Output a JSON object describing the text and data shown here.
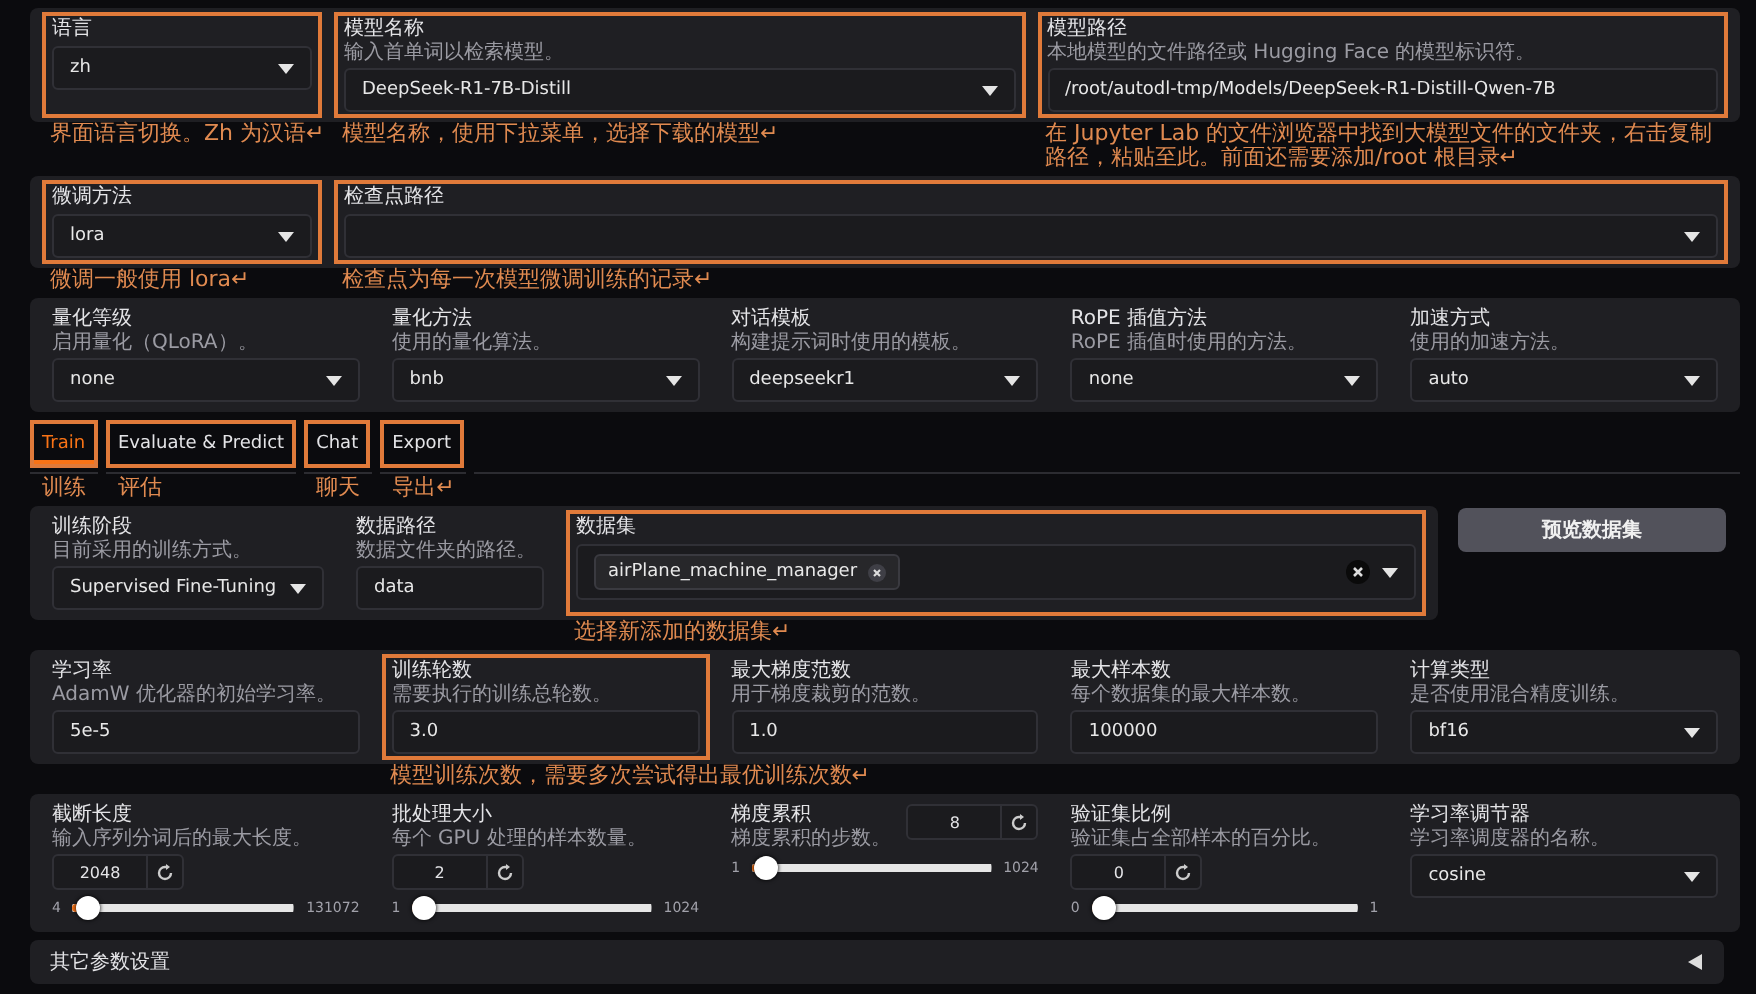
{
  "sections": [
    {
      "kind": "panel",
      "fields": [
        {
          "kind": "dropdown",
          "label": "语言",
          "value": "zh",
          "highlighted": true,
          "note": "界面语言切换。Zh 为汉语↵"
        },
        {
          "kind": "dropdown",
          "label": "模型名称",
          "description": "输入首单词以检索模型。",
          "value": "DeepSeek-R1-7B-Distill",
          "highlighted": true,
          "note": "模型名称，使用下拉菜单，选择下载的模型↵"
        },
        {
          "kind": "text",
          "label": "模型路径",
          "description": "本地模型的文件路径或 Hugging Face 的模型标识符。",
          "value": "/root/autodl-tmp/Models/DeepSeek-R1-Distill-Qwen-7B",
          "highlighted": true,
          "note": "在 Jupyter Lab 的文件浏览器中找到大模型文件的文件夹，右击复制路径，粘贴至此。前面还需要添加/root 根目录↵"
        }
      ]
    },
    {
      "kind": "panel",
      "fields": [
        {
          "kind": "dropdown",
          "label": "微调方法",
          "value": "lora",
          "highlighted": true,
          "note": "微调一般使用 lora↵"
        },
        {
          "kind": "dropdown",
          "label": "检查点路径",
          "highlighted": true,
          "note": "检查点为每一次模型微调训练的记录↵"
        }
      ]
    },
    {
      "kind": "panel",
      "fields": [
        {
          "kind": "dropdown",
          "label": "量化等级",
          "description": "启用量化（QLoRA）。",
          "value": "none"
        },
        {
          "kind": "dropdown",
          "label": "量化方法",
          "description": "使用的量化算法。",
          "value": "bnb"
        },
        {
          "kind": "dropdown",
          "label": "对话模板",
          "description": "构建提示词时使用的模板。",
          "value": "deepseekr1"
        },
        {
          "kind": "dropdown",
          "label": "RoPE 插值方法",
          "description": "RoPE 插值时使用的方法。",
          "value": "none"
        },
        {
          "kind": "dropdown",
          "label": "加速方式",
          "description": "使用的加速方法。",
          "value": "auto"
        }
      ]
    },
    {
      "kind": "tabs",
      "tabs": [
        {
          "label": "Train",
          "selected": true,
          "highlighted": true,
          "note": "训练"
        },
        {
          "label": "Evaluate & Predict",
          "selected": false,
          "highlighted": true,
          "note": "评估"
        },
        {
          "label": "Chat",
          "selected": false,
          "highlighted": true,
          "note": "聊天"
        },
        {
          "label": "Export",
          "selected": false,
          "highlighted": true,
          "note": "导出↵"
        }
      ]
    },
    {
      "kind": "panel",
      "button": "预览数据集",
      "fields": [
        {
          "kind": "dropdown",
          "label": "训练阶段",
          "description": "目前采用的训练方式。",
          "value": "Supervised Fine-Tuning"
        },
        {
          "kind": "text",
          "label": "数据路径",
          "description": "数据文件夹的路径。",
          "value": "data"
        },
        {
          "kind": "multiselect",
          "label": "数据集",
          "chips": [
            "airPlane_machine_manager"
          ],
          "highlighted": true,
          "note": "选择新添加的数据集↵"
        }
      ]
    },
    {
      "kind": "panel",
      "fields": [
        {
          "kind": "text",
          "label": "学习率",
          "description": "AdamW 优化器的初始学习率。",
          "value": "5e-5"
        },
        {
          "kind": "text",
          "label": "训练轮数",
          "description": "需要执行的训练总轮数。",
          "value": "3.0",
          "highlighted": true,
          "note": "模型训练次数，需要多次尝试得出最优训练次数↵"
        },
        {
          "kind": "text",
          "label": "最大梯度范数",
          "description": "用于梯度裁剪的范数。",
          "value": "1.0"
        },
        {
          "kind": "text",
          "label": "最大样本数",
          "description": "每个数据集的最大样本数。",
          "value": "100000"
        },
        {
          "kind": "dropdown",
          "label": "计算类型",
          "description": "是否使用混合精度训练。",
          "value": "bf16"
        }
      ]
    },
    {
      "kind": "panel",
      "fields": [
        {
          "kind": "slider",
          "label": "截断长度",
          "description": "输入序列分词后的最大长度。",
          "value": "2048",
          "min": "4",
          "max": "131072",
          "level": 0.016
        },
        {
          "kind": "slider",
          "label": "批处理大小",
          "description": "每个 GPU 处理的样本数量。",
          "value": "2",
          "min": "1",
          "max": "1024",
          "level": 0.001
        },
        {
          "kind": "slider",
          "label": "梯度累积",
          "description": "梯度累积的步数。",
          "value": "8",
          "min": "1",
          "max": "1024",
          "level": 0.007
        },
        {
          "kind": "slider",
          "label": "验证集比例",
          "description": "验证集占全部样本的百分比。",
          "value": "0",
          "min": "0",
          "max": "1",
          "level": 0
        },
        {
          "kind": "dropdown",
          "label": "学习率调节器",
          "description": "学习率调度器的名称。",
          "value": "cosine"
        }
      ]
    },
    {
      "kind": "accordion",
      "label": "其它参数设置",
      "expanded": false
    }
  ]
}
